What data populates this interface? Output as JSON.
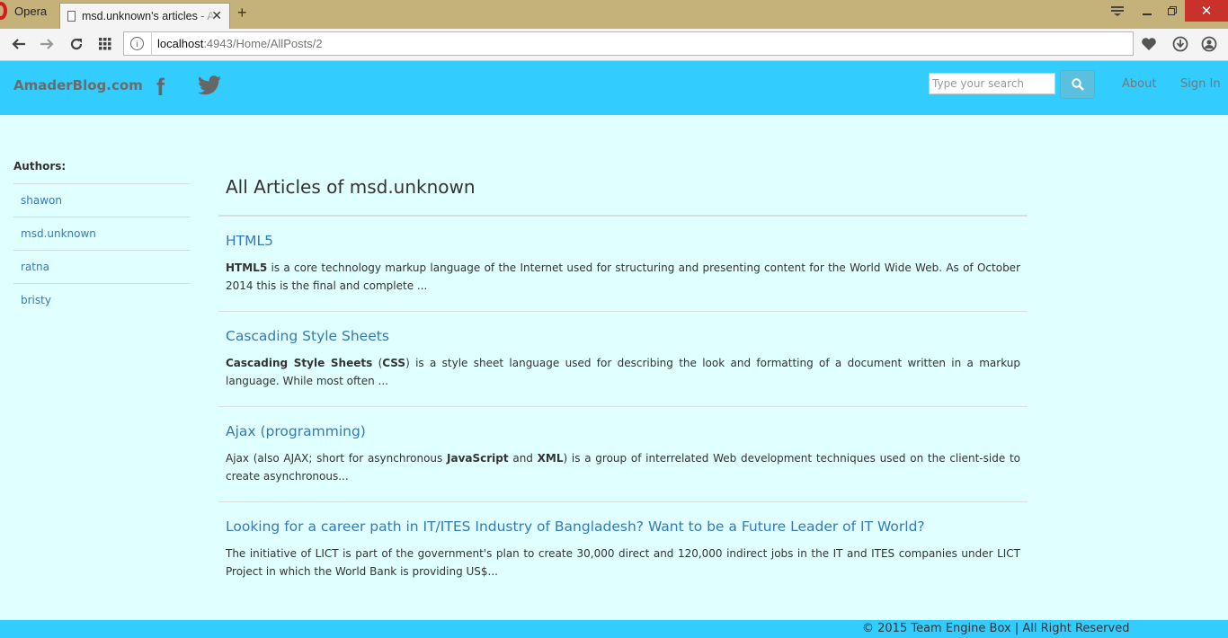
{
  "browser": {
    "app_name": "Opera",
    "tab_title": "msd.unknown's articles - AmaderBlog",
    "tab_close": "✕",
    "new_tab": "+",
    "url_host": "localhost",
    "url_rest": ":4943/Home/AllPosts/2"
  },
  "header": {
    "brand": "AmaderBlog.com",
    "facebook_glyph": "f",
    "search_placeholder": "Type your search",
    "nav_about": "About",
    "nav_signin": "Sign In",
    "accent_color": "#33ccff"
  },
  "sidebar": {
    "title": "Authors:",
    "authors": [
      "shawon",
      "msd.unknown",
      "ratna",
      "bristy"
    ]
  },
  "main": {
    "page_title": "All Articles of msd.unknown",
    "articles": [
      {
        "title": "HTML5",
        "excerpt_bold": "HTML5",
        "excerpt": " is a core technology markup language of the Internet used for structuring and presenting content for the World Wide Web. As of October 2014 this is the final and complete ..."
      },
      {
        "title": "Cascading Style Sheets",
        "excerpt_bold": "Cascading Style Sheets",
        "excerpt_mid1": " (",
        "excerpt_bold2": "CSS",
        "excerpt": ") is a style sheet language used for describing the look and formatting of a document written in a markup language. While most often ..."
      },
      {
        "title": "Ajax (programming)",
        "excerpt_pre": "Ajax (also AJAX; short for asynchronous ",
        "excerpt_bold": "JavaScript",
        "excerpt_mid": " and ",
        "excerpt_bold2": "XML",
        "excerpt": ") is a group of interrelated Web development techniques used on the client-side to create asynchronous..."
      },
      {
        "title": "Looking for a career path in IT/ITES Industry of Bangladesh? Want to be a Future Leader of IT World?",
        "excerpt": "The initiative of LICT is part of the government's plan to create 30,000 direct and 120,000 indirect jobs in the IT and ITES companies under LICT Project in which the World Bank is providing US$..."
      }
    ]
  },
  "footer": {
    "text": "© 2015 Team Engine Box | All Right Reserved"
  }
}
